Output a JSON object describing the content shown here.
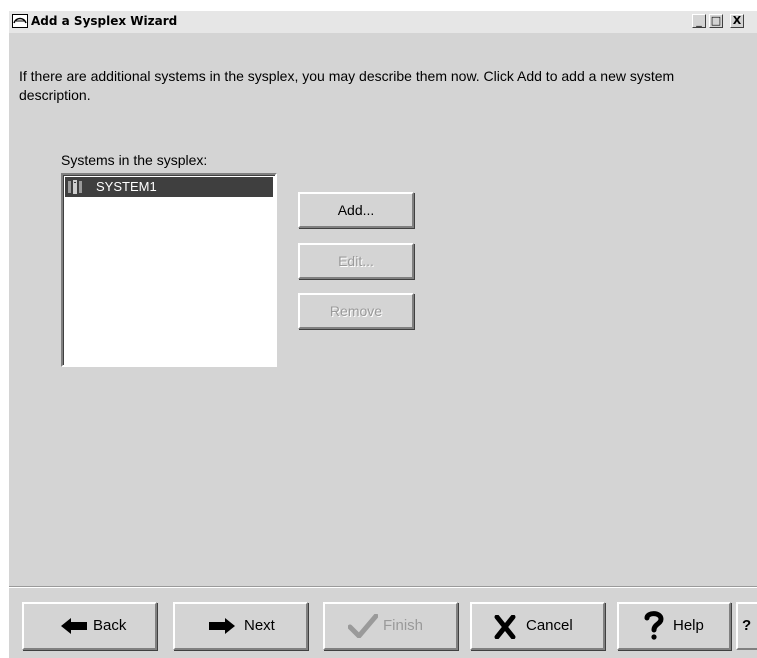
{
  "window": {
    "title": "Add a Sysplex Wizard",
    "minimize_glyph": "_",
    "maximize_glyph": "□",
    "close_glyph": "X"
  },
  "intro_text": "If there are additional systems in the sysplex, you may describe them now.  Click Add to add a new system description.",
  "systems_list": {
    "label": "Systems in the sysplex:",
    "items": [
      {
        "name": "SYSTEM1",
        "selected": true,
        "icon": "server-tower-icon"
      }
    ]
  },
  "side_buttons": {
    "add": {
      "label": "Add...",
      "enabled": true
    },
    "edit": {
      "label": "Edit...",
      "enabled": false
    },
    "remove": {
      "label": "Remove",
      "enabled": false
    }
  },
  "nav_buttons": {
    "back": {
      "label": "Back",
      "icon": "arrow-left-icon",
      "enabled": true
    },
    "next": {
      "label": "Next",
      "icon": "arrow-right-icon",
      "enabled": true
    },
    "finish": {
      "label": "Finish",
      "icon": "checkmark-icon",
      "enabled": false
    },
    "cancel": {
      "label": "Cancel",
      "icon": "x-icon",
      "enabled": true
    },
    "help": {
      "label": "Help",
      "icon": "question-mark-icon",
      "enabled": true
    },
    "context_help": {
      "label": "?",
      "enabled": true
    }
  },
  "colors": {
    "window_bg": "#d4d4d4",
    "titlebar_bg": "#e6e6e6",
    "selection_bg": "#3f3f3f",
    "disabled_text": "#9a9a9a"
  }
}
